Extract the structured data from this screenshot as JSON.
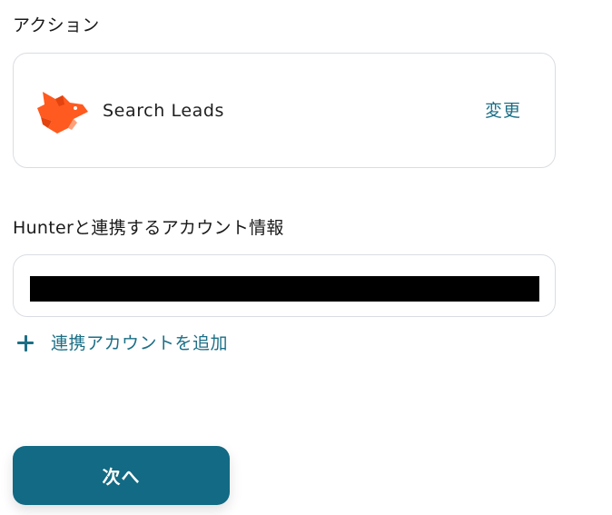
{
  "action_section": {
    "title": "アクション",
    "app_icon": "hunter-fox-icon",
    "action_name": "Search Leads",
    "change_label": "変更"
  },
  "account_section": {
    "title": "Hunterと連携するアカウント情報",
    "add_account_label": "連携アカウントを追加"
  },
  "footer": {
    "next_label": "次へ"
  },
  "colors": {
    "accent": "#1b6f86",
    "primary_button": "#126a84",
    "hunter_orange": "#ff5a1f",
    "border": "#d9dde3"
  }
}
